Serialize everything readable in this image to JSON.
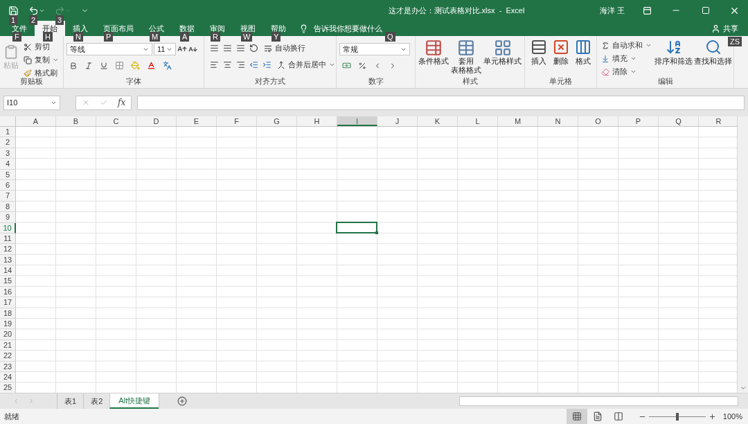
{
  "title_bar": {
    "quick_access": [
      {
        "kind": "save",
        "keytip": "1",
        "disabled": false
      },
      {
        "kind": "undo",
        "keytip": "2",
        "disabled": false
      },
      {
        "kind": "redo",
        "keytip": "3",
        "disabled": true
      }
    ],
    "title": "这才是办公：测试表格对比.xlsx  -  Excel",
    "user": "海洋 王"
  },
  "tabs": [
    {
      "label": "文件",
      "keytip": "F",
      "selected": false
    },
    {
      "label": "开始",
      "keytip": "H",
      "selected": true
    },
    {
      "label": "插入",
      "keytip": "N",
      "selected": false
    },
    {
      "label": "页面布局",
      "keytip": "P",
      "selected": false
    },
    {
      "label": "公式",
      "keytip": "M",
      "selected": false
    },
    {
      "label": "数据",
      "keytip": "A",
      "selected": false
    },
    {
      "label": "审阅",
      "keytip": "R",
      "selected": false
    },
    {
      "label": "视图",
      "keytip": "W",
      "selected": false
    },
    {
      "label": "帮助",
      "keytip": "Y",
      "selected": false
    }
  ],
  "tell_me": {
    "text": "告诉我你想要做什么",
    "keytip": "Q"
  },
  "share": {
    "label": "共享",
    "keytip": "ZS"
  },
  "ribbon": {
    "clipboard": {
      "title": "剪贴板",
      "paste": {
        "label": "粘贴",
        "disabled": true
      },
      "cut": "剪切",
      "copy": "复制",
      "format_painter": "格式刷"
    },
    "font": {
      "title": "字体",
      "font_name": "等线",
      "font_size": "11"
    },
    "alignment": {
      "title": "对齐方式",
      "wrap_text": "自动换行",
      "merge_center": "合并后居中"
    },
    "number": {
      "title": "数字",
      "format": "常规"
    },
    "styles": {
      "title": "样式",
      "buttons": [
        {
          "kind": "conditional",
          "label_lines": [
            "条件格式"
          ]
        },
        {
          "kind": "table",
          "label_lines": [
            "套用",
            "表格格式"
          ]
        },
        {
          "kind": "cell",
          "label_lines": [
            "单元格样式"
          ]
        }
      ]
    },
    "cells": {
      "title": "单元格",
      "buttons": [
        {
          "kind": "insert",
          "label": "插入"
        },
        {
          "kind": "delete",
          "label": "删除"
        },
        {
          "kind": "format",
          "label": "格式"
        }
      ]
    },
    "editing": {
      "title": "编辑",
      "autosum": "自动求和",
      "fill": "填充",
      "clear": "清除",
      "sort_filter": "排序和筛选",
      "find_select": "查找和选择"
    }
  },
  "formula_bar": {
    "name_box": "I10",
    "function_label": "fx"
  },
  "columns": [
    {
      "label": "A",
      "selected": false
    },
    {
      "label": "B",
      "selected": false
    },
    {
      "label": "C",
      "selected": false
    },
    {
      "label": "D",
      "selected": false
    },
    {
      "label": "E",
      "selected": false
    },
    {
      "label": "F",
      "selected": false
    },
    {
      "label": "G",
      "selected": false
    },
    {
      "label": "H",
      "selected": false
    },
    {
      "label": "I",
      "selected": true
    },
    {
      "label": "J",
      "selected": false
    },
    {
      "label": "K",
      "selected": false
    },
    {
      "label": "L",
      "selected": false
    },
    {
      "label": "M",
      "selected": false
    },
    {
      "label": "N",
      "selected": false
    },
    {
      "label": "O",
      "selected": false
    },
    {
      "label": "P",
      "selected": false
    },
    {
      "label": "Q",
      "selected": false
    },
    {
      "label": "R",
      "selected": false
    }
  ],
  "rows": [
    {
      "label": "1",
      "selected": false
    },
    {
      "label": "2",
      "selected": false
    },
    {
      "label": "3",
      "selected": false
    },
    {
      "label": "4",
      "selected": false
    },
    {
      "label": "5",
      "selected": false
    },
    {
      "label": "6",
      "selected": false
    },
    {
      "label": "7",
      "selected": false
    },
    {
      "label": "8",
      "selected": false
    },
    {
      "label": "9",
      "selected": false
    },
    {
      "label": "10",
      "selected": true
    },
    {
      "label": "11",
      "selected": false
    },
    {
      "label": "12",
      "selected": false
    },
    {
      "label": "13",
      "selected": false
    },
    {
      "label": "14",
      "selected": false
    },
    {
      "label": "15",
      "selected": false
    },
    {
      "label": "16",
      "selected": false
    },
    {
      "label": "17",
      "selected": false
    },
    {
      "label": "18",
      "selected": false
    },
    {
      "label": "19",
      "selected": false
    },
    {
      "label": "20",
      "selected": false
    },
    {
      "label": "21",
      "selected": false
    },
    {
      "label": "22",
      "selected": false
    },
    {
      "label": "23",
      "selected": false
    },
    {
      "label": "24",
      "selected": false
    },
    {
      "label": "25",
      "selected": false
    }
  ],
  "sheets": [
    {
      "label": "表1",
      "selected": false
    },
    {
      "label": "表2",
      "selected": false
    },
    {
      "label": "Alt快捷键",
      "selected": true
    }
  ],
  "status_bar": {
    "status": "就绪",
    "views": [
      {
        "kind": "normal",
        "selected": true
      },
      {
        "kind": "page_layout",
        "selected": false
      },
      {
        "kind": "page_break",
        "selected": false
      }
    ],
    "zoom": {
      "level": 0.5,
      "reading": "100%"
    }
  }
}
